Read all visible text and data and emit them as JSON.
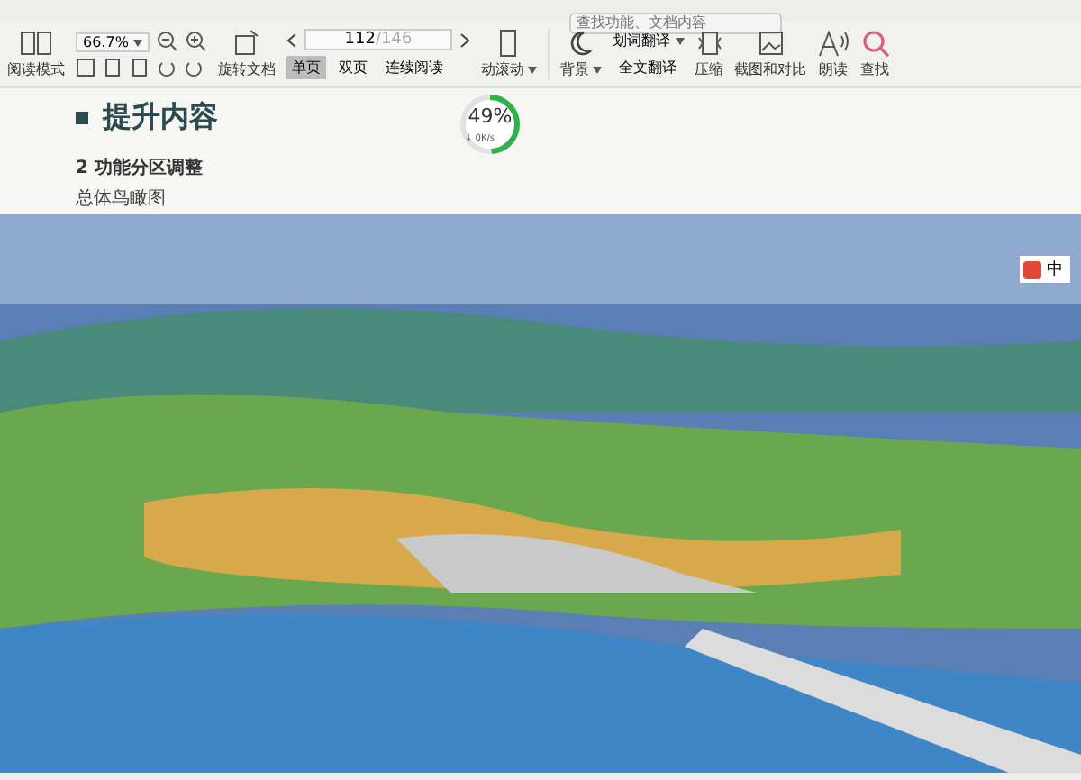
{
  "search": {
    "placeholder": "查找功能、文档内容"
  },
  "toolbar": {
    "read_mode": "阅读模式",
    "zoom": "66.7%",
    "rotate": "旋转文档",
    "page": "112",
    "page_total": "/146",
    "view_modes": [
      {
        "label": "单页",
        "selected": true
      },
      {
        "label": "双页",
        "selected": false
      },
      {
        "label": "连续阅读",
        "selected": false
      }
    ],
    "auto_scroll": "动滚动",
    "background": "背景",
    "word_translate": "划词翻译",
    "full_translate": "全文翻译",
    "compress": "压缩",
    "screenshot_compare": "截图和对比",
    "read_aloud": "朗读",
    "find": "查找"
  },
  "progress": {
    "level": 0.49,
    "percent": "49%",
    "speed": "↓ 0K/s"
  },
  "document": {
    "heading": "提升内容",
    "subheading": "2 功能分区调整",
    "caption": "总体鸟瞰图"
  },
  "ime": {
    "label": "中"
  }
}
